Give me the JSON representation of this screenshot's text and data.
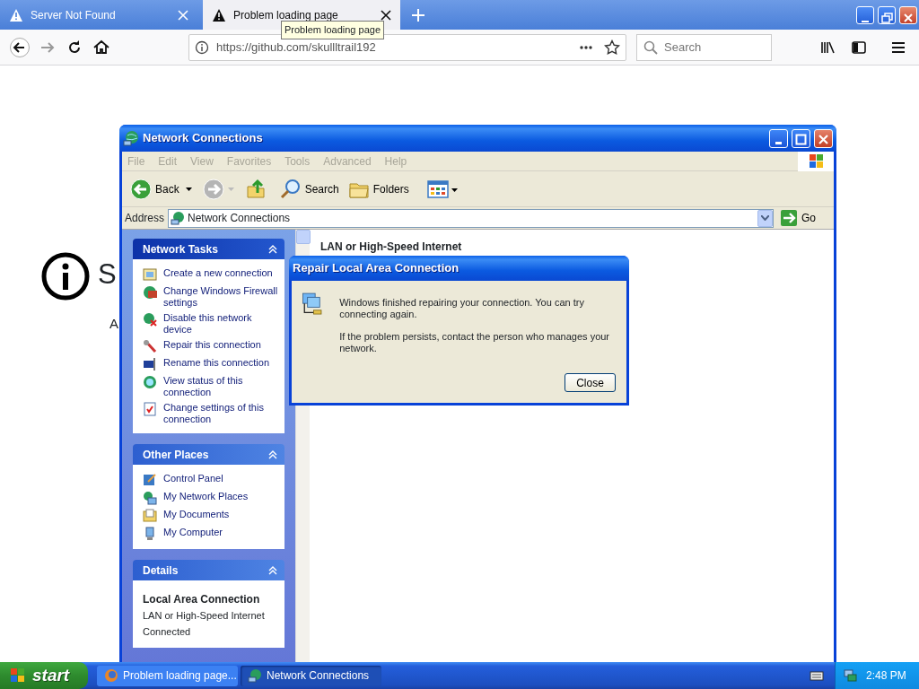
{
  "browser": {
    "tabs": [
      {
        "label": "Server Not Found",
        "selected": false
      },
      {
        "label": "Problem loading page",
        "selected": true
      }
    ],
    "tooltip": "Problem loading page",
    "url": "https://github.com/skullltrail192",
    "search": {
      "placeholder": "Search"
    }
  },
  "page": {
    "title": "S",
    "text": "A"
  },
  "explorer": {
    "title": "Network Connections",
    "menu": [
      {
        "label": "File",
        "disabled": true
      },
      {
        "label": "Edit",
        "disabled": true
      },
      {
        "label": "View",
        "disabled": true
      },
      {
        "label": "Favorites",
        "disabled": true
      },
      {
        "label": "Tools",
        "disabled": true
      },
      {
        "label": "Advanced",
        "disabled": true
      },
      {
        "label": "Help",
        "disabled": true
      }
    ],
    "toolbar": {
      "back": "Back",
      "search": "Search",
      "folders": "Folders"
    },
    "address_label": "Address",
    "address": "Network Connections",
    "go": "Go",
    "panels": [
      {
        "kind": "tasks",
        "title": "Network Tasks",
        "items": [
          "Create a new connection",
          "Change Windows Firewall settings",
          "Disable this network device",
          "Repair this connection",
          "Rename this connection",
          "View status of this connection",
          "Change settings of this connection"
        ]
      },
      {
        "kind": "places",
        "title": "Other Places",
        "items": [
          "Control Panel",
          "My Network Places",
          "My Documents",
          "My Computer"
        ]
      },
      {
        "kind": "details",
        "title": "Details",
        "name": "Local Area Connection",
        "lines": [
          "LAN or High-Speed Internet",
          "Connected"
        ]
      }
    ],
    "group_heading": "LAN or High-Speed Internet"
  },
  "dialog": {
    "title": "Repair Local Area Connection",
    "paragraphs": [
      "Windows finished repairing your connection. You can try connecting again.",
      "If the problem persists, contact the person who manages your network."
    ],
    "button": "Close"
  },
  "taskbar": {
    "start": "start",
    "tasks": [
      {
        "label": "Problem loading page...",
        "selected": false
      },
      {
        "label": "Network Connections",
        "selected": true
      }
    ],
    "clock": "2:48 PM"
  }
}
